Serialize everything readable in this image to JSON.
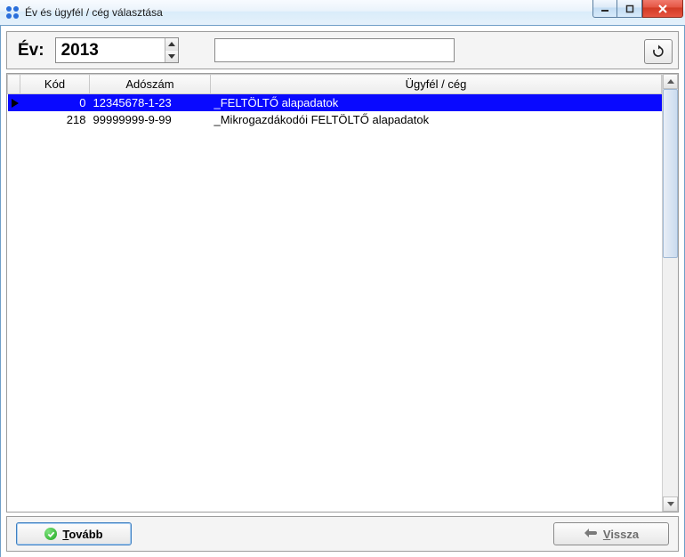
{
  "window": {
    "title": "Év és ügyfél / cég választása"
  },
  "top": {
    "year_label": "Év:",
    "year_value": "2013",
    "search_value": ""
  },
  "grid": {
    "headers": {
      "kod": "Kód",
      "adoszam": "Adószám",
      "ugyfel": "Ügyfél / cég"
    },
    "rows": [
      {
        "selected": true,
        "kod": "0",
        "adoszam": "12345678-1-23",
        "nev": "_FELTÖLTŐ alapadatok"
      },
      {
        "selected": false,
        "kod": "218",
        "adoszam": "99999999-9-99",
        "nev": "_Mikrogazdákodói FELTÖLTŐ alapadatok"
      }
    ]
  },
  "buttons": {
    "next_prefix": "T",
    "next_rest": "ovább",
    "back_prefix": "V",
    "back_rest": "issza"
  }
}
